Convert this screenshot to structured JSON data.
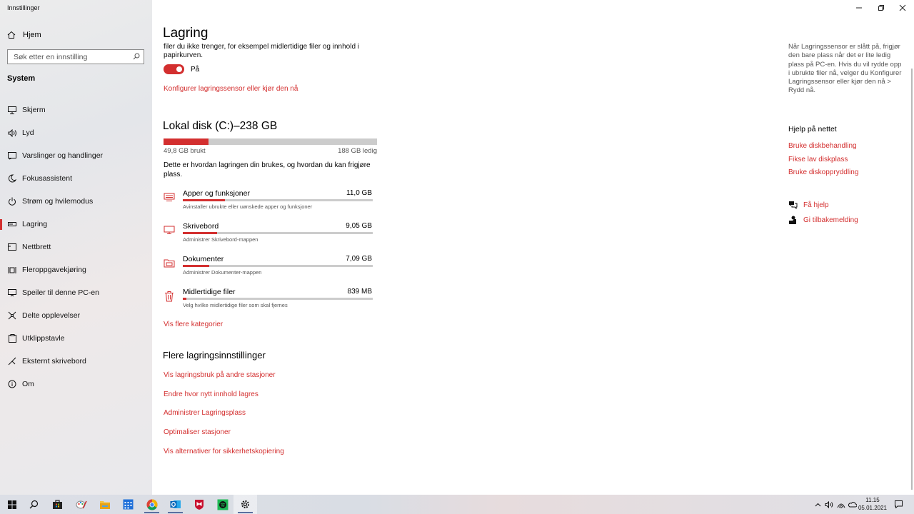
{
  "window": {
    "title": "Innstillinger"
  },
  "sidebar": {
    "home_label": "Hjem",
    "search_placeholder": "Søk etter en innstilling",
    "section": "System",
    "items": [
      {
        "label": "Skjerm",
        "icon": "monitor-icon"
      },
      {
        "label": "Lyd",
        "icon": "speaker-icon"
      },
      {
        "label": "Varslinger og handlinger",
        "icon": "notification-icon"
      },
      {
        "label": "Fokusassistent",
        "icon": "moon-icon"
      },
      {
        "label": "Strøm og hvilemodus",
        "icon": "power-icon"
      },
      {
        "label": "Lagring",
        "icon": "storage-icon",
        "active": true
      },
      {
        "label": "Nettbrett",
        "icon": "tablet-icon"
      },
      {
        "label": "Fleroppgavekjøring",
        "icon": "multitasking-icon"
      },
      {
        "label": "Speiler til denne PC-en",
        "icon": "project-icon"
      },
      {
        "label": "Delte opplevelser",
        "icon": "share-icon"
      },
      {
        "label": "Utklippstavle",
        "icon": "clipboard-icon"
      },
      {
        "label": "Eksternt skrivebord",
        "icon": "remote-desktop-icon"
      },
      {
        "label": "Om",
        "icon": "info-icon"
      }
    ]
  },
  "main": {
    "title": "Lagring",
    "clipped_text": "filer du ikke trenger, for eksempel midlertidige filer og innhold i papirkurven.",
    "toggle_label": "På",
    "toggle_on": true,
    "configure_link": "Konfigurer lagringssensor eller kjør den nå",
    "disk": {
      "title": "Lokal disk (C:)–238 GB",
      "used_label": "49,8 GB brukt",
      "free_label": "188 GB ledig",
      "used_fraction": 0.21,
      "description": "Dette er hvordan lagringen din brukes, og hvordan du kan frigjøre plass."
    },
    "categories": [
      {
        "name": "Apper og funksjoner",
        "size": "11,0 GB",
        "sub": "Avinstaller ubrukte eller uønskede apper og funksjoner",
        "fraction": 0.22,
        "icon": "apps-icon"
      },
      {
        "name": "Skrivebord",
        "size": "9,05 GB",
        "sub": "Administrer Skrivebord-mappen",
        "fraction": 0.18,
        "icon": "desktop-icon"
      },
      {
        "name": "Dokumenter",
        "size": "7,09 GB",
        "sub": "Administrer Dokumenter-mappen",
        "fraction": 0.14,
        "icon": "documents-icon"
      },
      {
        "name": "Midlertidige filer",
        "size": "839 MB",
        "sub": "Velg hvilke midlertidige filer som skal fjernes",
        "fraction": 0.02,
        "icon": "trash-icon"
      }
    ],
    "show_more": "Vis flere kategorier",
    "more_title": "Flere lagringsinnstillinger",
    "more_links": [
      "Vis lagringsbruk på andre stasjoner",
      "Endre hvor nytt innhold lagres",
      "Administrer Lagringsplass",
      "Optimaliser stasjoner",
      "Vis alternativer for sikkerhetskopiering"
    ]
  },
  "right": {
    "help_text": "Når Lagringssensor er slått på, frigjør den bare plass når det er lite ledig plass på PC-en. Hvis du vil rydde opp i ubrukte filer nå, velger du Konfigurer Lagringssensor eller kjør den nå > Rydd nå.",
    "help_heading": "Hjelp på nettet",
    "help_links": [
      "Bruke diskbehandling",
      "Fikse lav diskplass",
      "Bruke diskoppryddling"
    ],
    "get_help": "Få hjelp",
    "feedback": "Gi tilbakemelding"
  },
  "taskbar": {
    "time": "11.15",
    "date": "05.01.2021",
    "apps": [
      "start-icon",
      "search-icon",
      "store-icon",
      "paint-icon",
      "file-explorer-icon",
      "calendar-icon",
      "chrome-icon",
      "outlook-icon",
      "mcafee-icon",
      "spotify-icon",
      "settings-icon"
    ]
  },
  "colors": {
    "accent": "#d32f2f",
    "sidebar_bg": "#e8e8ea",
    "bar_bg": "#cccccc"
  }
}
